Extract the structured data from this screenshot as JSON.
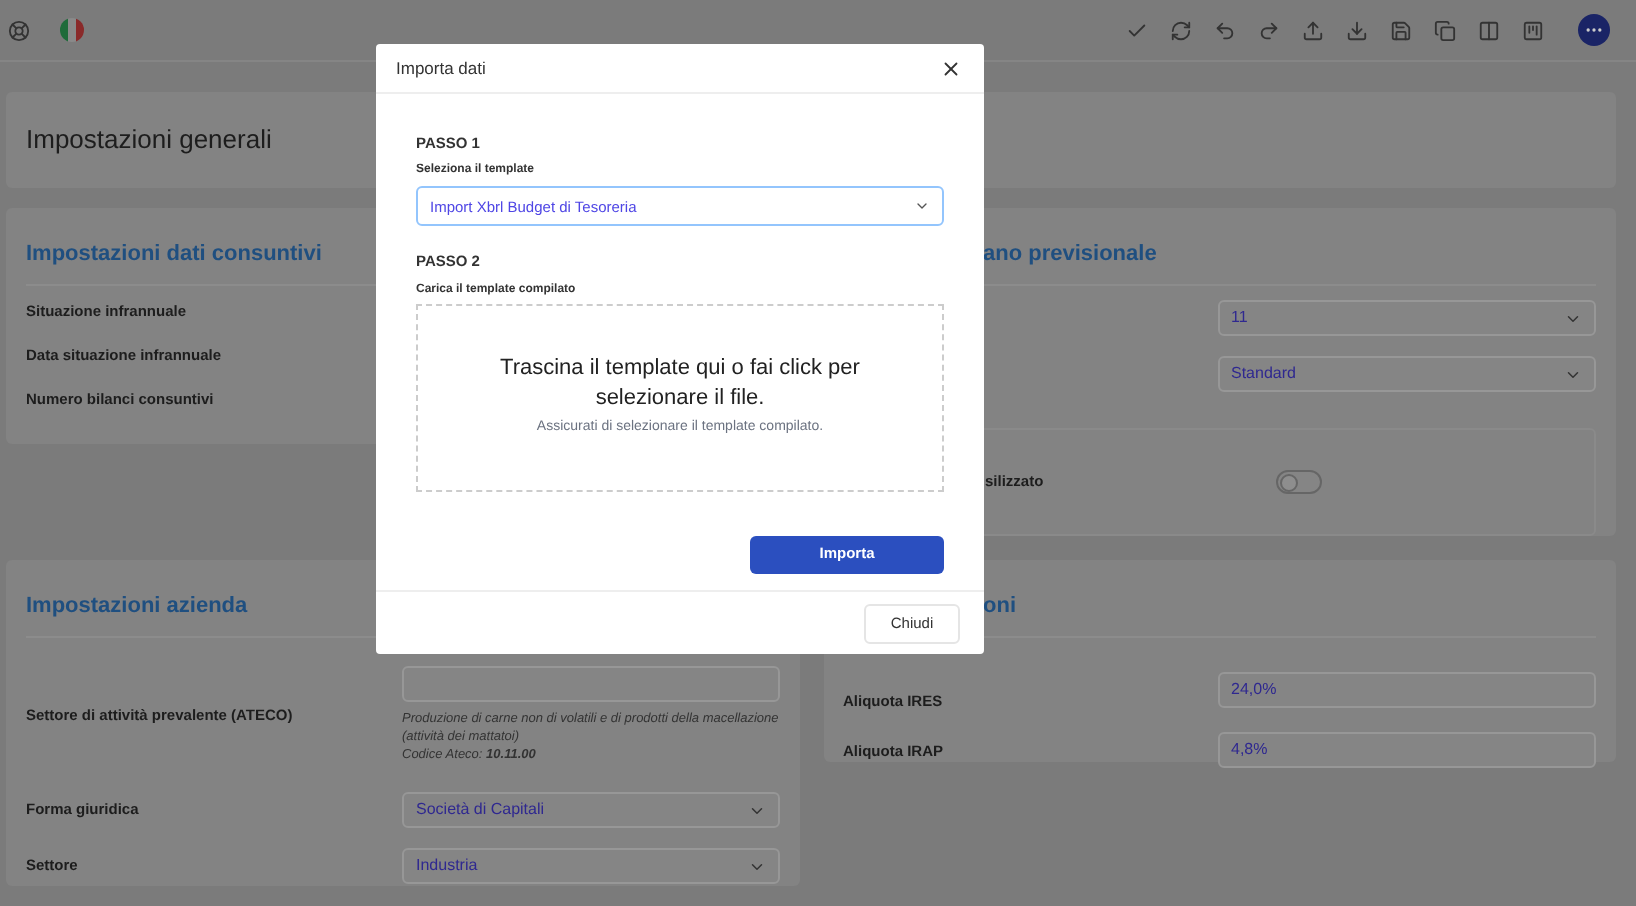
{
  "general": {
    "title": "Impostazioni generali"
  },
  "actuals": {
    "title": "Impostazioni dati consuntivi",
    "rows": [
      {
        "label": "Situazione infrannuale"
      },
      {
        "label": "Data situazione infrannuale"
      },
      {
        "label": "Numero bilanci consuntivi"
      }
    ]
  },
  "forecast": {
    "title": "ano previsionale",
    "selects": [
      {
        "value": "11"
      },
      {
        "value": "Standard"
      }
    ],
    "toggle": {
      "label": "silizzato",
      "on": false
    }
  },
  "company": {
    "title": "Impostazioni azienda",
    "ateco": {
      "label": "Settore di attività prevalente (ATECO)",
      "description": "Produzione di carne non di volatili e di prodotti della macellazione (attività dei mattatoi)",
      "code": "Codice Ateco: **10.11.00**"
    },
    "selects": [
      {
        "label": "Forma giuridica",
        "value": "Società di Capitali"
      },
      {
        "label": "Settore",
        "value": "Industria"
      }
    ]
  },
  "taxes": {
    "title": "oni",
    "rows": [
      {
        "label": "Aliquota IRES",
        "value": "24,0%"
      },
      {
        "label": "Aliquota IRAP",
        "value": "4,8%"
      }
    ]
  },
  "dialog": {
    "title": "Importa dati",
    "step1": {
      "heading": "PASSO 1",
      "label": "Seleziona il template",
      "value": "Import Xbrl Budget di Tesoreria"
    },
    "step2": {
      "heading": "PASSO 2",
      "label": "Carica il template compilato",
      "drop_text": "Trascina il template qui o fai click per selezionare il file.",
      "hint": "Assicurati di selezionare il template compilato."
    },
    "submit": "Importa",
    "close": "Chiudi"
  }
}
